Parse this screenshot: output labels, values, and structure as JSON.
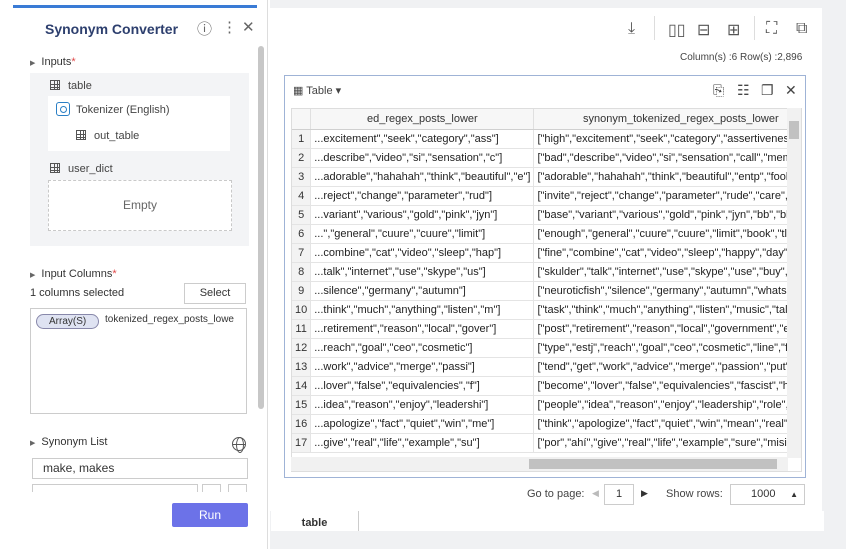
{
  "left": {
    "title": "Synonym Converter",
    "help_icon": "?",
    "more_icon": "⋮",
    "close_icon": "✕",
    "inputs_label": "Inputs",
    "required_mark": "*",
    "table_node": "table",
    "tokenizer_node": "Tokenizer (English)",
    "out_table_node": "out_table",
    "user_dict_node": "user_dict",
    "empty_label": "Empty",
    "input_columns_label": "Input Columns",
    "columns_selected": "1 columns selected",
    "select_button": "Select",
    "column_type_tag": "Array(S)",
    "column_name": "tokenized_regex_posts_lowe",
    "synonym_list_label": "Synonym List",
    "synonym_value": "make, makes",
    "run_button": "Run"
  },
  "toolbar": {
    "col_row_info": "Column(s) :6   Row(s) :2,896"
  },
  "table_panel": {
    "title": "Table",
    "dropdown": "▾",
    "columns": [
      "",
      "ed_regex_posts_lower",
      "synonym_tokenized_regex_posts_lower"
    ],
    "rows": [
      [
        "1",
        "[\"excitement\",\"seek\",\"category\",\"ass...",
        "[\"high\",\"excitement\",\"seek\",\"category\",\"assertiveness\",\"c..."
      ],
      [
        "2",
        "[\"describe\",\"video\",\"si\",\"sensation\",\"c...",
        "[\"bad\",\"describe\",\"video\",\"si\",\"sensation\",\"call\",\"memory\",..."
      ],
      [
        "3",
        "[\"adorable\",\"hahahah\",\"think\",\"beautiful\",\"e...",
        "[\"adorable\",\"hahahah\",\"think\",\"beautiful\",\"entp\",\"fool\",\"so..."
      ],
      [
        "4",
        "[\"reject\",\"change\",\"parameter\",\"rud...",
        "[\"invite\",\"reject\",\"change\",\"parameter\",\"rude\",\"care\",\"prer..."
      ],
      [
        "5",
        "[\"variant\",\"various\",\"gold\",\"pink\",\"jyn...",
        "[\"base\",\"variant\",\"various\",\"gold\",\"pink\",\"jyn\",\"bb\",\"black\",..."
      ],
      [
        "6",
        "[\"general\",\"cuure\",\"cuure\",\"limit\",\"...",
        "[\"enough\",\"general\",\"cuure\",\"cuure\",\"limit\",\"book\",\"tl\",\"r\",\"..."
      ],
      [
        "7",
        "[\"combine\",\"cat\",\"video\",\"sleep\",\"hap...",
        "[\"fine\",\"combine\",\"cat\",\"video\",\"sleep\",\"happy\",\"day\",\"pos..."
      ],
      [
        "8",
        "[\"talk\",\"internet\",\"use\",\"skype\",\"us...",
        "[\"skulder\",\"talk\",\"internet\",\"use\",\"skype\",\"use\",\"buy\",\"dkkr..."
      ],
      [
        "9",
        "[\"silence\",\"germany\",\"autumn...",
        "[\"neuroticfish\",\"silence\",\"germany\",\"autumn\",\"whats\",\"pro..."
      ],
      [
        "10",
        "[\"think\",\"much\",\"anything\",\"listen\",\"m...",
        "[\"task\",\"think\",\"much\",\"anything\",\"listen\",\"music\",\"talk\",\"s..."
      ],
      [
        "11",
        "[\"retirement\",\"reason\",\"local\",\"gover...",
        "[\"post\",\"retirement\",\"reason\",\"local\",\"government\",\"emplo..."
      ],
      [
        "12",
        "[\"reach\",\"goal\",\"ceo\",\"cosmetic...",
        "[\"type\",\"estj\",\"reach\",\"goal\",\"ceo\",\"cosmetic\",\"line\",\"famo..."
      ],
      [
        "13",
        "[\"work\",\"advice\",\"merge\",\"passi...",
        "[\"tend\",\"get\",\"work\",\"advice\",\"merge\",\"passion\",\"put\",\"righ..."
      ],
      [
        "14",
        "[\"lover\",\"false\",\"equivalencies\",\"f...",
        "[\"become\",\"lover\",\"false\",\"equivalencies\",\"fascist\",\"hate\",\"..."
      ],
      [
        "15",
        "[\"idea\",\"reason\",\"enjoy\",\"leadershi...",
        "[\"people\",\"idea\",\"reason\",\"enjoy\",\"leadership\",\"role\",\"peo..."
      ],
      [
        "16",
        "[\"apologize\",\"fact\",\"quiet\",\"win\",\"me...",
        "[\"think\",\"apologize\",\"fact\",\"quiet\",\"win\",\"mean\",\"real\",\"worl..."
      ],
      [
        "17",
        "[\"give\",\"real\",\"life\",\"example\",\"su...",
        "[\"por\",\"ahí\",\"give\",\"real\",\"life\",\"example\",\"sure\",\"misinterp..."
      ]
    ]
  },
  "pager": {
    "goto_label": "Go to page:",
    "page": "1",
    "rows_label": "Show rows:",
    "rows": "1000"
  },
  "bottom_tab": "table"
}
